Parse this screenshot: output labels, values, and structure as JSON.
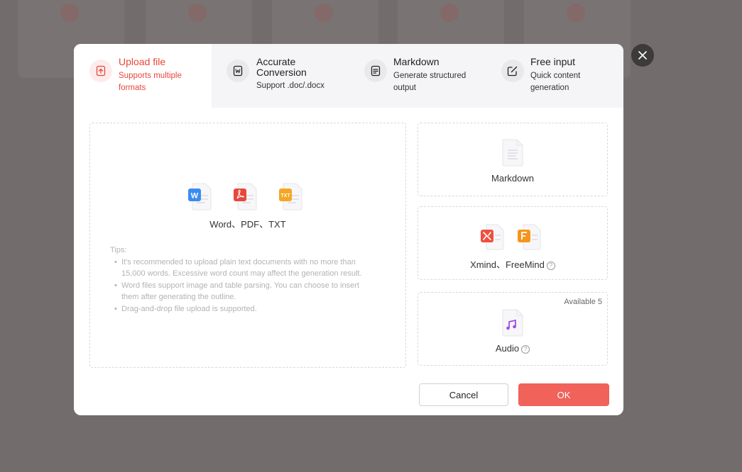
{
  "tabs": [
    {
      "title": "Upload file",
      "subtitle_lines": [
        "Supports multiple",
        "formats"
      ],
      "icon": "upload-icon",
      "active": true
    },
    {
      "title_lines": [
        "Accurate",
        "Conversion"
      ],
      "subtitle": "Support .doc/.docx",
      "icon": "word-doc-icon"
    },
    {
      "title": "Markdown",
      "subtitle_lines": [
        "Generate structured",
        "output"
      ],
      "icon": "document-icon"
    },
    {
      "title": "Free input",
      "subtitle_lines": [
        "Quick content",
        "generation"
      ],
      "icon": "edit-icon"
    }
  ],
  "upload": {
    "file_types": [
      {
        "icon": "word-file-icon",
        "badge": "W",
        "color": "#3b8cf0"
      },
      {
        "icon": "pdf-file-icon",
        "badge": "",
        "color": "#e8473c"
      },
      {
        "icon": "txt-file-icon",
        "badge": "TXT",
        "color": "#f5a623"
      }
    ],
    "formats_label": "Word、PDF、TXT",
    "tips_title": "Tips:",
    "tips": [
      [
        "It's recommended to upload plain text documents with no more than",
        "15,000 words. Excessive word count may affect the generation result."
      ],
      [
        "Word files support image and table parsing. You can choose to insert",
        "them after generating the outline."
      ],
      [
        "Drag-and-drop file upload is supported."
      ]
    ]
  },
  "side_options": {
    "markdown": {
      "label": "Markdown",
      "icon": "markdown-file-icon"
    },
    "mindmap": {
      "label": "Xmind、FreeMind",
      "icons": [
        "xmind-file-icon",
        "freemind-file-icon"
      ],
      "help": "?"
    },
    "audio": {
      "label": "Audio",
      "icon": "audio-file-icon",
      "help": "?",
      "badge": "Available 5"
    }
  },
  "buttons": {
    "cancel": "Cancel",
    "ok": "OK"
  },
  "colors": {
    "accent": "#f0625a",
    "active_text": "#e8473c",
    "overlay": "#7a7272"
  }
}
